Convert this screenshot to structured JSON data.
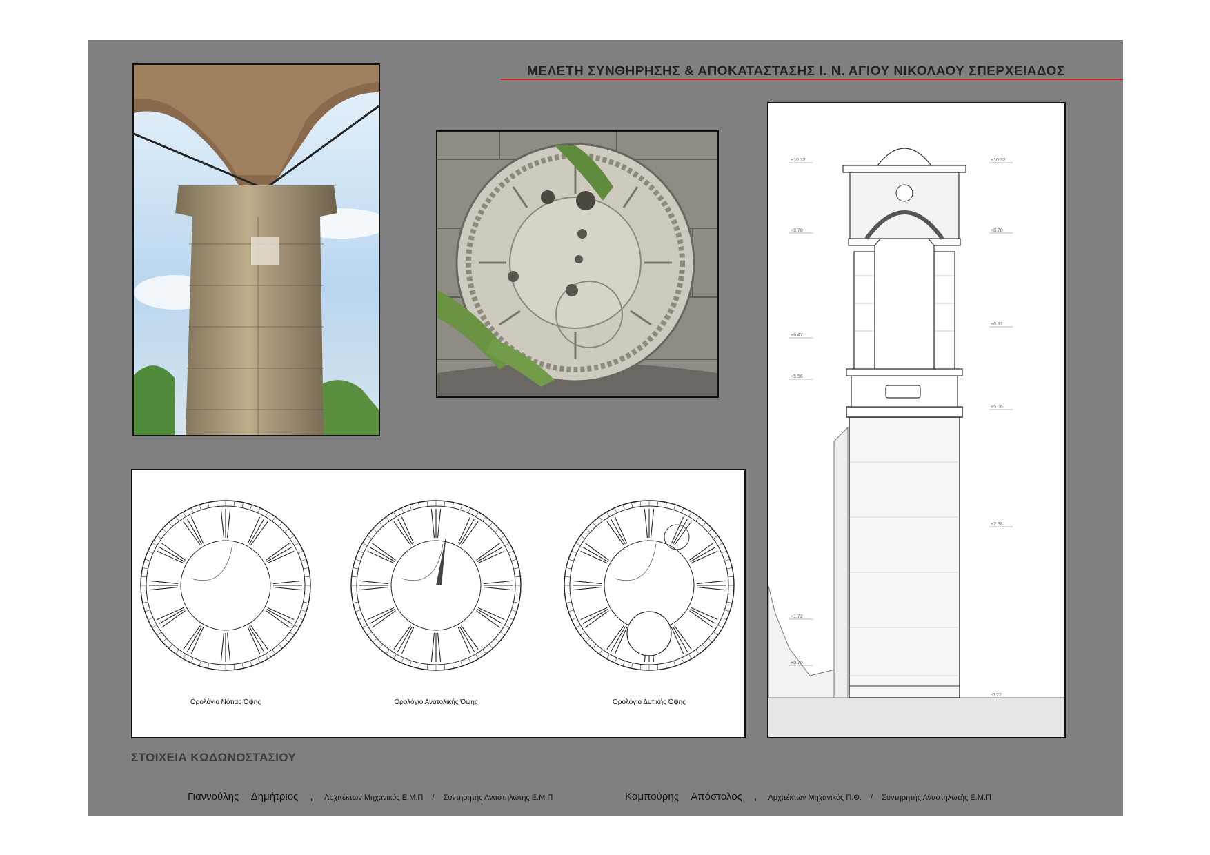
{
  "header": {
    "title": "ΜΕΛΕΤΗ ΣΥΝΘΗΡΗΣΗΣ & ΑΠΟΚΑΤΑΣΤΑΣΗΣ Ι. Ν. ΑΓΙΟΥ ΝΙΚΟΛΑΟΥ ΣΠΕΡΧΕΙΑΔΟΣ",
    "accent_color": "#cc1f1f"
  },
  "clocks": {
    "captions": [
      "Ορολόγιο Νότιας Όψης",
      "Ορολόγιο Ανατολικής Όψης",
      "Ορολόγιο Δυτικής Όψης"
    ]
  },
  "tower": {
    "elevations_left": [
      "+10.32",
      "+8.78",
      "+6.47",
      "+5.56",
      "+1.72",
      "+0.70"
    ],
    "elevations_right": [
      "+10.32",
      "+8.78",
      "+6.81",
      "+5.06",
      "+2.38",
      "-0.22"
    ]
  },
  "section_title": "ΣΤΟΙΧΕΙΑ ΚΩΔΩΝΟΣΤΑΣΙΟΥ",
  "credits": [
    {
      "name": "Γιαννούλης Δημήτριος",
      "comma": ",",
      "role1": "Αρχιτέκτων Μηχανικός Ε.Μ.Π",
      "slash": "/",
      "role2": "Συντηρητής Αναστηλωτής Ε.Μ.Π"
    },
    {
      "name": "Καμπούρης Απόστολος",
      "comma": ",",
      "role1": "Αρχιτέκτων Μηχανικός Π.Θ.",
      "slash": "/",
      "role2": "Συντηρητής Αναστηλωτής Ε.Μ.Π"
    }
  ],
  "board_color": "#808080"
}
